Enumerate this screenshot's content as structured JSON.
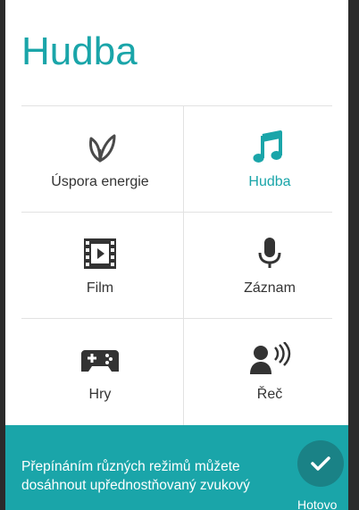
{
  "dialog": {
    "title": "Hudba",
    "accent_color": "#1aa5a9",
    "modes": [
      {
        "label": "Úspora energie",
        "icon": "leaf-icon",
        "selected": false
      },
      {
        "label": "Hudba",
        "icon": "music-note-icon",
        "selected": true
      },
      {
        "label": "Film",
        "icon": "film-icon",
        "selected": false
      },
      {
        "label": "Záznam",
        "icon": "microphone-icon",
        "selected": false
      },
      {
        "label": "Hry",
        "icon": "gamepad-icon",
        "selected": false
      },
      {
        "label": "Řeč",
        "icon": "speech-icon",
        "selected": false
      }
    ],
    "footer": {
      "hint": "Přepínáním různých režimů můžete dosáhnout upřednostňovaný zvukový",
      "done_label": "Hotovo",
      "done_icon": "checkmark-icon"
    }
  }
}
